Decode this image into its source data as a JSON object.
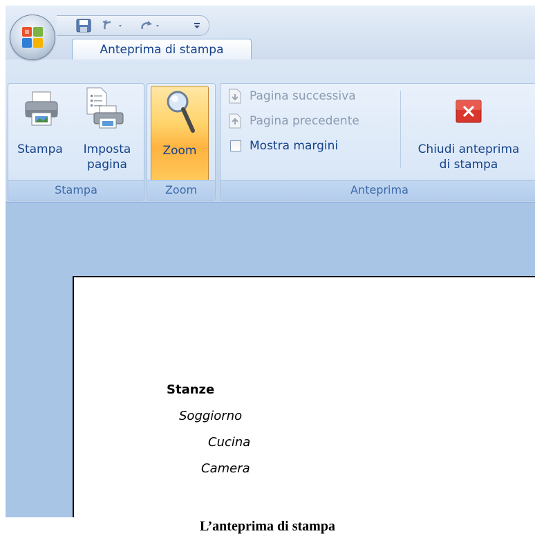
{
  "tabs": [
    {
      "label": "Anteprima di stampa"
    }
  ],
  "ribbon": {
    "stampa_group": {
      "label": "Stampa",
      "print_button": "Stampa",
      "page_setup_line1": "Imposta",
      "page_setup_line2": "pagina"
    },
    "zoom_group": {
      "label": "Zoom",
      "zoom_button": "Zoom"
    },
    "anteprima_group": {
      "label": "Anteprima",
      "next_page": "Pagina successiva",
      "prev_page": "Pagina precedente",
      "show_margins": "Mostra margini",
      "show_margins_checked": false,
      "close_line1": "Chiudi anteprima",
      "close_line2": "di stampa"
    }
  },
  "page": {
    "heading": "Stanze",
    "items": [
      "Soggiorno",
      "Cucina",
      "Camera"
    ]
  },
  "caption": "L’anteprima di stampa",
  "colors": {
    "accent": "#15428b",
    "ribbon": "#c9dbf0",
    "preview_bg": "#a9c5e6",
    "zoom_active": "#ffc85a",
    "close_red": "#d9362c"
  }
}
